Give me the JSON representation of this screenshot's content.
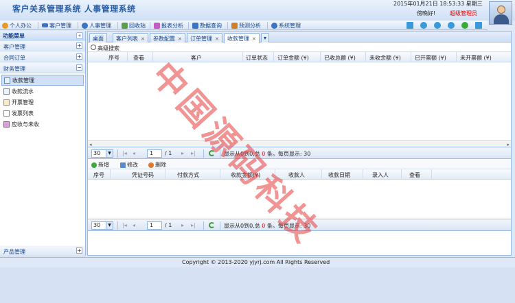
{
  "header": {
    "title": "客户关系管理系统 人事管理系统",
    "datetime": "2015年01月21日 18:53:33 星期三",
    "greeting": "傍晚好!",
    "role": "超级管理员"
  },
  "topnav": [
    {
      "label": "个人办公",
      "icon": "user-icon",
      "color": "#e59a2a"
    },
    {
      "label": "客户管理",
      "icon": "card-icon",
      "color": "#3b74c4"
    },
    {
      "label": "人事管理",
      "icon": "people-icon",
      "color": "#3b74c4"
    },
    {
      "label": "回收站",
      "icon": "recycle-icon",
      "color": "#5aa04a"
    },
    {
      "label": "报表分析",
      "icon": "report-icon",
      "color": "#c65ac4"
    },
    {
      "label": "数据查询",
      "icon": "database-icon",
      "color": "#3b74c4"
    },
    {
      "label": "预测分析",
      "icon": "chart-icon",
      "color": "#d0802a"
    },
    {
      "label": "系统管理",
      "icon": "gear-icon",
      "color": "#3b74c4"
    }
  ],
  "toolicons": [
    {
      "name": "home-icon",
      "color": "#3a9ad9"
    },
    {
      "name": "lock-icon",
      "color": "#3a9ad9"
    },
    {
      "name": "refresh-icon",
      "color": "#3a9ad9"
    },
    {
      "name": "help-icon",
      "color": "#3a9ad9"
    },
    {
      "name": "chat-icon",
      "color": "#3aaa3a"
    },
    {
      "name": "exit-icon",
      "color": "#3a9ad9"
    }
  ],
  "leftpanel": {
    "title": "功能菜单",
    "sections": [
      "客户管理",
      "合同订单",
      "财务管理"
    ],
    "items": [
      "收款管理",
      "收款流水",
      "开票管理",
      "发票列表",
      "应收与未收"
    ],
    "bottom_section": "产品管理"
  },
  "tabs": [
    {
      "label": "桌面",
      "closable": false
    },
    {
      "label": "客户列表",
      "closable": true
    },
    {
      "label": "参数配置",
      "closable": true
    },
    {
      "label": "订单管理",
      "closable": true
    },
    {
      "label": "收款管理",
      "closable": true
    }
  ],
  "advanced_search": "高级搜索",
  "grid1": {
    "columns": [
      "序号",
      "查看",
      "客户",
      "订单状态",
      "订单金额 (¥)",
      "已收总额 (¥)",
      "未收余额 (¥)",
      "已开票额 (¥)",
      "未开票额 (¥)"
    ]
  },
  "pager": {
    "page_size": "30",
    "page": "1",
    "of_total": "/ 1",
    "info_prefix": "显示从0到0,总",
    "info_count": "0",
    "info_suffix": "条。每页显示: 30"
  },
  "toolbar2": {
    "add": "新增",
    "edit": "修改",
    "delete": "删除"
  },
  "grid2": {
    "columns": [
      "序号",
      "凭证号码",
      "付款方式",
      "收款金额(¥)",
      "收款人",
      "收款日期",
      "录入人",
      "查看"
    ]
  },
  "footer": {
    "copyright": "Copyright © 2013-2020 yjyrj.com All Rights Reserved"
  },
  "watermark": "中国源码科技"
}
